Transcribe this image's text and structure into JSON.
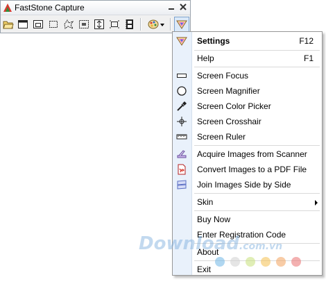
{
  "window": {
    "title": "FastStone Capture"
  },
  "toolbar": {
    "tools": [
      {
        "name": "open-file-icon"
      },
      {
        "name": "capture-active-window-icon"
      },
      {
        "name": "capture-window-object-icon"
      },
      {
        "name": "capture-rectangular-region-icon"
      },
      {
        "name": "capture-freehand-region-icon"
      },
      {
        "name": "capture-full-screen-icon"
      },
      {
        "name": "capture-scrolling-window-icon"
      },
      {
        "name": "capture-fixed-region-icon"
      },
      {
        "name": "screen-recorder-icon"
      },
      {
        "name": "output-palette-icon"
      },
      {
        "name": "settings-menu-icon"
      }
    ]
  },
  "menu": {
    "settings": {
      "label": "Settings",
      "shortcut": "F12"
    },
    "help": {
      "label": "Help",
      "shortcut": "F1"
    },
    "screen_focus": {
      "label": "Screen Focus"
    },
    "screen_magnifier": {
      "label": "Screen Magnifier"
    },
    "screen_color_picker": {
      "label": "Screen Color Picker"
    },
    "screen_crosshair": {
      "label": "Screen Crosshair"
    },
    "screen_ruler": {
      "label": "Screen Ruler"
    },
    "acquire_scanner": {
      "label": "Acquire Images from Scanner"
    },
    "convert_pdf": {
      "label": "Convert Images to a PDF File"
    },
    "join_images": {
      "label": "Join Images Side by Side"
    },
    "skin": {
      "label": "Skin"
    },
    "buy_now": {
      "label": "Buy Now"
    },
    "registration": {
      "label": "Enter Registration Code"
    },
    "about": {
      "label": "About"
    },
    "exit": {
      "label": "Exit"
    }
  },
  "watermark": {
    "text": "Download",
    "suffix": ".com.vn"
  },
  "colors": {
    "gutter": "#e9f1fb",
    "hover_border": "#7da2ce",
    "watermark_dots": [
      "#6fb7e6",
      "#d0d0d0",
      "#c6e07a",
      "#f4c04e",
      "#f2a35c",
      "#e96f6f"
    ]
  }
}
